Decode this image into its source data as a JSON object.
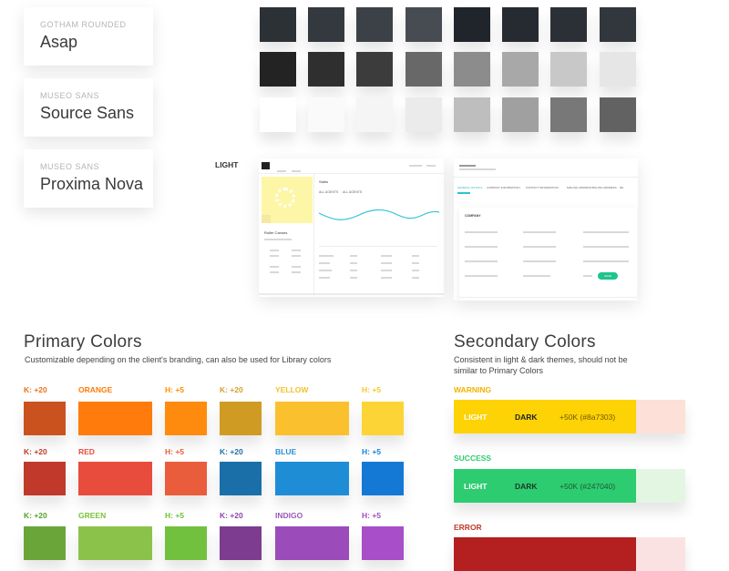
{
  "fonts": [
    {
      "alias": "GOTHAM ROUNDED",
      "name": "Asap"
    },
    {
      "alias": "MUSEO SANS",
      "name": "Source Sans"
    },
    {
      "alias": "MUSEO SANS",
      "name": "Proxima Nova"
    }
  ],
  "grays": {
    "row1": [
      "#2c3136",
      "#34393f",
      "#3c4147",
      "#474c52",
      "#1f252b",
      "#262b31",
      "#2b3036",
      "#32373d"
    ],
    "row2": [
      "#232323",
      "#2f2f2f",
      "#3c3c3c",
      "#686868",
      "#8c8c8c",
      "#a8a8a8",
      "#c8c8c8",
      "#e6e6e6"
    ],
    "row3": [
      "#ffffff",
      "#fafafa",
      "#f5f5f5",
      "#ebebeb",
      "#bebebe",
      "#a0a0a0",
      "#787878",
      "#626262"
    ]
  },
  "light_label": "LIGHT",
  "mockup_left": {
    "profile_name": "Roller Canoes",
    "chart_title": "Sales",
    "filter1": "ALL AGENTS",
    "filter2": "ALL AGENTS"
  },
  "mockup_right": {
    "section": "COMPANY",
    "tabs": [
      "GENERAL DETAILS",
      "COMPANY INFORMATION",
      "CONTACT INFORMATION",
      "MAILING ADDRESS",
      "BILLING ADDRESS",
      "DE"
    ],
    "button": "SAVE"
  },
  "primary": {
    "title": "Primary Colors",
    "subtitle": "Customizable depending on the client's branding, can also be used for Library colors",
    "rows": [
      {
        "labels": [
          "K: +20",
          "ORANGE",
          "H: +5",
          "K: +20",
          "YELLOW",
          "H: +5"
        ],
        "label_colors": [
          "#e8731b",
          "#ff7a00",
          "#ff8c00",
          "#d4a02a",
          "#f6c02a",
          "#f7c820"
        ],
        "colors": [
          "#c9521e",
          "#ff7b0b",
          "#ff8b0e",
          "#cf9b23",
          "#fbc02d",
          "#fdd435"
        ]
      },
      {
        "labels": [
          "K: +20",
          "RED",
          "H: +5",
          "K: +20",
          "BLUE",
          "H: +5"
        ],
        "label_colors": [
          "#c0392b",
          "#e74c3c",
          "#e95c3c",
          "#1f6fa8",
          "#2a8fd6",
          "#1b7fd8"
        ],
        "colors": [
          "#c0392b",
          "#e74c3c",
          "#e95d3c",
          "#1a6fa9",
          "#1f8dd6",
          "#1479d4"
        ]
      },
      {
        "labels": [
          "K: +20",
          "GREEN",
          "H: +5",
          "K: +20",
          "INDIGO",
          "H: +5"
        ],
        "label_colors": [
          "#5aa02c",
          "#7cc13b",
          "#6cc23a",
          "#8e44ad",
          "#9b59b6",
          "#a04dc0"
        ],
        "colors": [
          "#6aa53a",
          "#8bc34a",
          "#72c13e",
          "#7d3c8f",
          "#9b4bba",
          "#a84ec8"
        ]
      }
    ]
  },
  "secondary": {
    "title": "Secondary Colors",
    "subtitle": "Consistent in light & dark themes, should not be similar to Primary Colors",
    "groups": [
      {
        "name": "WARNING",
        "name_color": "#f0b400",
        "light": "LIGHT",
        "dark": "DARK",
        "code": "+50K (#8a7303)",
        "color": "#fdd305",
        "tint": "#fde0d8"
      },
      {
        "name": "SUCCESS",
        "name_color": "#2ecc71",
        "light": "LIGHT",
        "dark": "DARK",
        "code": "+50K (#247040)",
        "color": "#2ecc71",
        "tint": "#e2f6e2"
      },
      {
        "name": "ERROR",
        "name_color": "#c0392b",
        "color": "#b3201f",
        "tint": "#fbe2e2"
      }
    ]
  }
}
